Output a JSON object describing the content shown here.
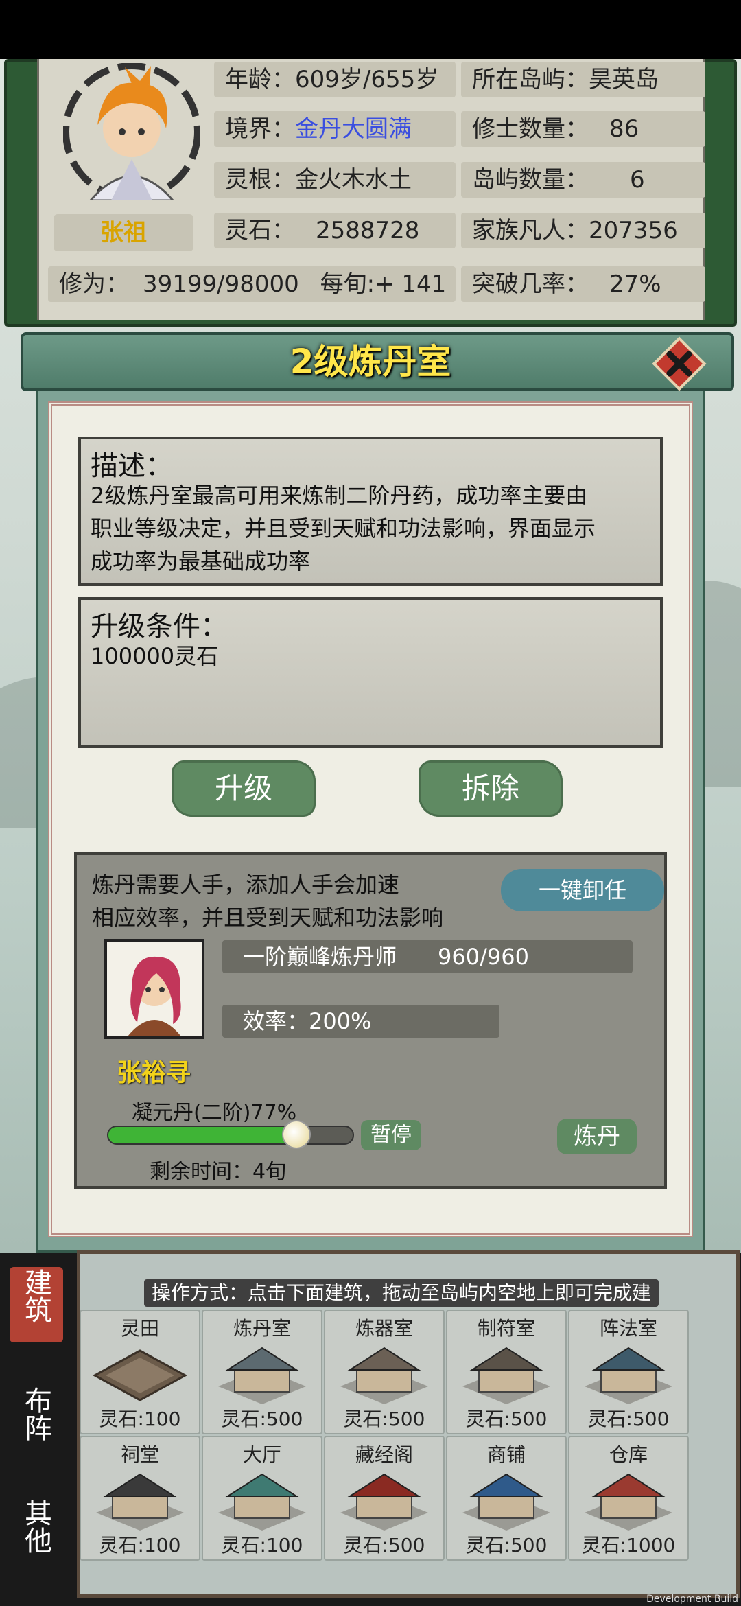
{
  "character": {
    "name": "张祖",
    "age_label": "年龄：",
    "age_value": "609岁/655岁",
    "realm_label": "境界：",
    "realm_value": "金丹大圆满",
    "root_label": "灵根：",
    "root_value": "金火木水土",
    "stone_label": "灵石：",
    "stone_value": "2588728",
    "cultivation_label": "修为：",
    "cultivation_value": "39199/98000",
    "per_turn_label": "每旬:",
    "per_turn_value": "+ 141",
    "island_label": "所在岛屿：",
    "island_value": "昊英岛",
    "cultivators_label": "修士数量：",
    "cultivators_value": "86",
    "islands_label": "岛屿数量：",
    "islands_value": "6",
    "mortals_label": "家族凡人：",
    "mortals_value": "207356",
    "breakthrough_label": "突破几率：",
    "breakthrough_value": "27%"
  },
  "dialog": {
    "title": "2级炼丹室",
    "desc_title": "描述：",
    "desc_lines": [
      "2级炼丹室最高可用来炼制二阶丹药，成功率主要由",
      "职业等级决定，并且受到天赋和功法影响，界面显示",
      "成功率为最基础成功率"
    ],
    "upgrade_title": "升级条件：",
    "upgrade_cost": "100000灵石",
    "upgrade_button": "升级",
    "demolish_button": "拆除"
  },
  "worker": {
    "hint_line1": "炼丹需要人手，添加人手会加速",
    "hint_line2": "相应效率，并且受到天赋和功法影响",
    "unload_button": "一键卸任",
    "rank": "一阶巅峰炼丹师",
    "exp": "960/960",
    "efficiency": "效率：200%",
    "name": "张裕寻",
    "task": "凝元丹(二阶)77%",
    "progress": 0.77,
    "pause_button": "暂停",
    "craft_button": "炼丹",
    "remaining": "剩余时间：4旬"
  },
  "build": {
    "tabs": [
      "建筑",
      "布阵",
      "其他"
    ],
    "instruction": "操作方式：点击下面建筑，拖动至岛屿内空地上即可完成建设",
    "items": [
      {
        "name": "灵田",
        "cost": "灵石:100"
      },
      {
        "name": "炼丹室",
        "cost": "灵石:500"
      },
      {
        "name": "炼器室",
        "cost": "灵石:500"
      },
      {
        "name": "制符室",
        "cost": "灵石:500"
      },
      {
        "name": "阵法室",
        "cost": "灵石:500"
      },
      {
        "name": "祠堂",
        "cost": "灵石:100"
      },
      {
        "name": "大厅",
        "cost": "灵石:100"
      },
      {
        "name": "藏经阁",
        "cost": "灵石:500"
      },
      {
        "name": "商铺",
        "cost": "灵石:500"
      },
      {
        "name": "仓库",
        "cost": "灵石:1000"
      }
    ]
  },
  "footer": "Development Build",
  "colors": {
    "title": "#ffe64a",
    "realm": "#3a4ee0",
    "name": "#d9a400",
    "progress": "#3fb436"
  }
}
